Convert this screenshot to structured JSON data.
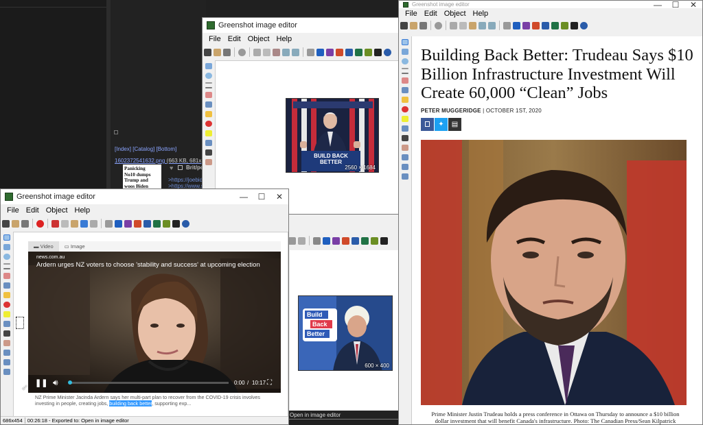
{
  "app_name": "Greenshot image editor",
  "menus": [
    "File",
    "Edit",
    "Object",
    "Help"
  ],
  "window_controls": {
    "minimize": "—",
    "maximize": "☐",
    "close": "✕"
  },
  "background_thread": {
    "nav": "[Index] [Catalog] [Bottom]",
    "filename": "1602372541632.png",
    "file_meta": "(663 KB, 681x",
    "news_thumb_text": "Panicking\nNo10 dumps\nTrump and\nwoos Biden",
    "post_name": "Brit/po",
    "link1": ">https://joebid",
    "link2": ">https://www.s"
  },
  "win_top_middle": {
    "title": "Greenshot image editor",
    "thumb_dims": "2560 × 1684",
    "podium_text": "BUILD BACK BETTER",
    "podium_sub": "BIDEN"
  },
  "win_back_middle": {
    "thumb_dims": "600 × 400",
    "sign_lines": [
      "Build",
      "Back",
      "Better"
    ],
    "status_text": "Open in image editor"
  },
  "win_left": {
    "title": "Greenshot image editor",
    "tabs": [
      "Video",
      "Image"
    ],
    "source": "news.com.au",
    "headline": "Ardern urges NZ voters to choose 'stability and success' at upcoming election",
    "time_current": "0:00",
    "time_separator": "/",
    "time_total": "10:17",
    "caption_before": "NZ Prime Minister Jacinda Ardern says her multi-part plan to recover from the COVID-19 crisis involves investing in people, creating jobs, ",
    "caption_highlight": "building back better",
    "caption_after": ", supporting exp...",
    "status_dims": "686x454",
    "status_text": "00:26:18 - Exported to: Open in image editor",
    "video_progress": 0
  },
  "win_right": {
    "title": "Greenshot image editor",
    "article_title": "Building Back Better: Trudeau Says $10 Billion Infrastructure Investment Will Create 60,000 “Clean” Jobs",
    "author": "PETER MUGGERIDGE",
    "byline_sep": "|",
    "date": "OCTOBER 1ST, 2020",
    "share_icons": [
      "facebook-icon",
      "twitter-icon",
      "print-icon"
    ],
    "caption": "Prime Minister Justin Trudeau holds a press conference in Ottawa on Thursday to announce a $10 billion dollar investment that will benefit Canada's infrastructure. Photo: The Canadian Press/Sean Kilpatrick"
  },
  "colors": {
    "facebook": "#3b5998",
    "twitter": "#1da1f2",
    "print": "#333333",
    "highlight": "#3399ff",
    "dark_bg": "#1e1e1e"
  }
}
